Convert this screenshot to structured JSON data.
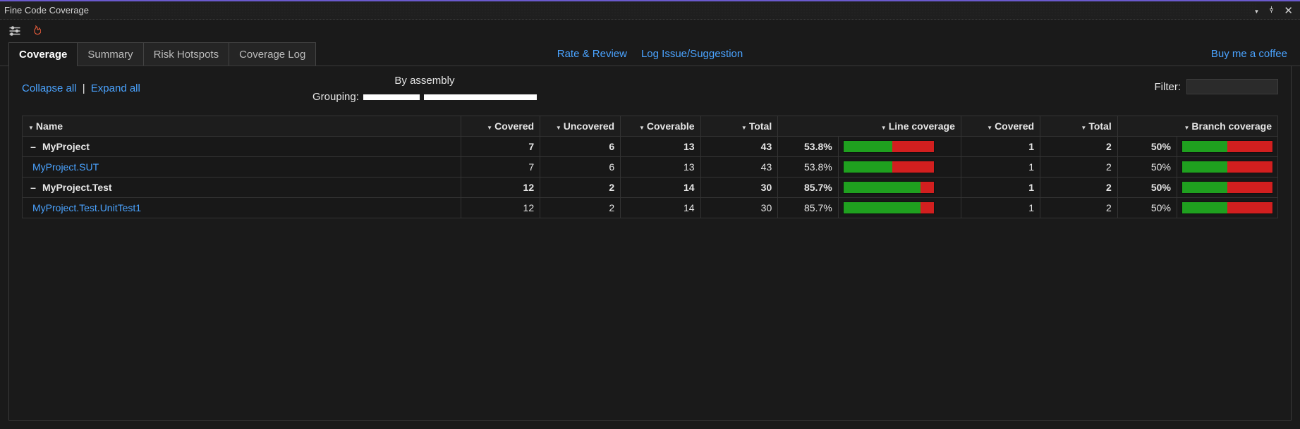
{
  "window": {
    "title": "Fine Code Coverage"
  },
  "tabs": [
    {
      "label": "Coverage",
      "active": true
    },
    {
      "label": "Summary",
      "active": false
    },
    {
      "label": "Risk Hotspots",
      "active": false
    },
    {
      "label": "Coverage Log",
      "active": false
    }
  ],
  "links": {
    "rate_review": "Rate & Review",
    "log_issue": "Log Issue/Suggestion",
    "buy_coffee": "Buy me a coffee"
  },
  "controls": {
    "collapse_all": "Collapse all",
    "expand_all": "Expand all",
    "grouping_label": "Grouping:",
    "grouping_heading": "By assembly",
    "filter_label": "Filter:",
    "filter_value": ""
  },
  "columns": {
    "name": "Name",
    "covered": "Covered",
    "uncovered": "Uncovered",
    "coverable": "Coverable",
    "total": "Total",
    "line_coverage": "Line coverage",
    "b_covered": "Covered",
    "b_total": "Total",
    "branch_coverage": "Branch coverage"
  },
  "rows": [
    {
      "type": "group",
      "toggle": "–",
      "name": "MyProject",
      "covered": 7,
      "uncovered": 6,
      "coverable": 13,
      "total": 43,
      "line_pct": "53.8%",
      "line_bar": 53.8,
      "b_covered": 1,
      "b_total": 2,
      "b_pct": "50%",
      "b_bar": 50
    },
    {
      "type": "child",
      "name": "MyProject.SUT",
      "covered": 7,
      "uncovered": 6,
      "coverable": 13,
      "total": 43,
      "line_pct": "53.8%",
      "line_bar": 53.8,
      "b_covered": 1,
      "b_total": 2,
      "b_pct": "50%",
      "b_bar": 50
    },
    {
      "type": "group",
      "toggle": "–",
      "name": "MyProject.Test",
      "covered": 12,
      "uncovered": 2,
      "coverable": 14,
      "total": 30,
      "line_pct": "85.7%",
      "line_bar": 85.7,
      "b_covered": 1,
      "b_total": 2,
      "b_pct": "50%",
      "b_bar": 50
    },
    {
      "type": "child",
      "name": "MyProject.Test.UnitTest1",
      "covered": 12,
      "uncovered": 2,
      "coverable": 14,
      "total": 30,
      "line_pct": "85.7%",
      "line_bar": 85.7,
      "b_covered": 1,
      "b_total": 2,
      "b_pct": "50%",
      "b_bar": 50
    }
  ]
}
